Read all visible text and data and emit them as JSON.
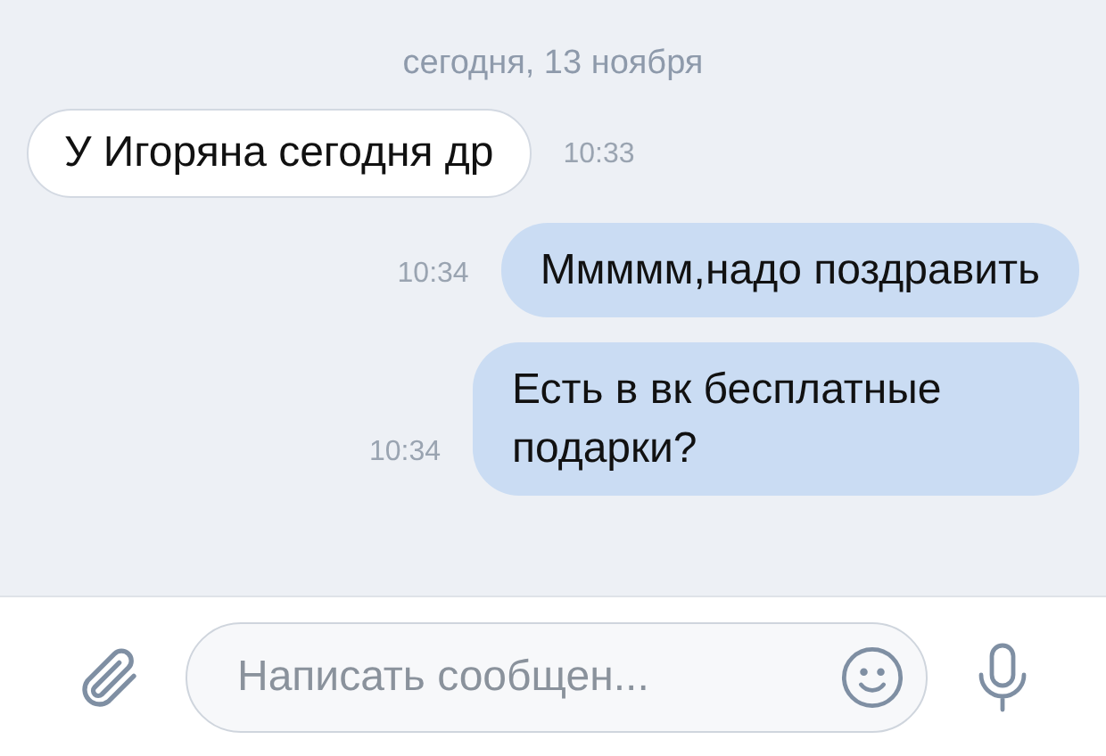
{
  "date_header": "сегодня, 13 ноября",
  "messages": [
    {
      "kind": "incoming",
      "text": "У Игоряна сегодня др",
      "time": "10:33"
    },
    {
      "kind": "outgoing",
      "text": "Ммммм,надо поздравить",
      "time": "10:34"
    },
    {
      "kind": "outgoing",
      "text": "Есть в вк бесплатные подарки?",
      "time": "10:34"
    }
  ],
  "composer": {
    "placeholder": "Написать сообщен..."
  }
}
